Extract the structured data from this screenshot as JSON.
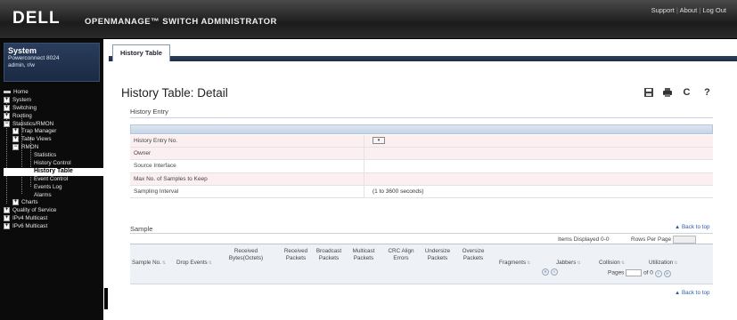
{
  "header": {
    "logo": "DELL",
    "app_title": "OPENMANAGE™ SWITCH ADMINISTRATOR",
    "links": {
      "support": "Support",
      "about": "About",
      "logout": "Log Out",
      "sep": "|"
    }
  },
  "system": {
    "title": "System",
    "model": "Powerconnect 8024",
    "user": "admin, r/w"
  },
  "nav": {
    "home": "Home",
    "system": "System",
    "switching": "Switching",
    "routing": "Routing",
    "statistics_rmon": "Statistics/RMON",
    "trap_manager": "Trap Manager",
    "table_views": "Table Views",
    "rmon": "RMON",
    "rmon_statistics": "Statistics",
    "history_control": "History Control",
    "history_table": "History Table",
    "event_control": "Event Control",
    "events_log": "Events Log",
    "alarms": "Alarms",
    "charts": "Charts",
    "qos": "Quality of Service",
    "ipv4_multicast": "IPv4 Multicast",
    "ipv6_multicast": "IPv6 Multicast"
  },
  "tabs": {
    "active": "History Table"
  },
  "page": {
    "title": "History Table: Detail",
    "toolbar": {
      "save_icon": "save-icon",
      "print_icon": "print-icon",
      "refresh_icon": "refresh-icon",
      "help_icon": "help-icon"
    }
  },
  "history_entry": {
    "heading": "History Entry",
    "rows": [
      {
        "label": "History Entry No.",
        "value": ""
      },
      {
        "label": "Owner",
        "value": ""
      },
      {
        "label": "Source Interface",
        "value": ""
      },
      {
        "label": "Max No. of Samples to Keep",
        "value": ""
      },
      {
        "label": "Sampling Interval",
        "value": "(1 to 3600 seconds)"
      }
    ]
  },
  "sample": {
    "heading": "Sample",
    "back_to_top": "Back to top",
    "items_displayed": "Items Displayed 0-0",
    "rows_per_page": "Rows Per Page",
    "columns": [
      {
        "label": "Sample No."
      },
      {
        "label": "Drop Events"
      },
      {
        "label": "Received Bytes(Octets)"
      },
      {
        "label": "Received Packets"
      },
      {
        "label": "Broadcast Packets"
      },
      {
        "label": "Multicast Packets"
      },
      {
        "label": "CRC Align Errors"
      },
      {
        "label": "Undersize Packets"
      },
      {
        "label": "Oversize Packets"
      },
      {
        "label": "Fragments"
      },
      {
        "label": "Jabbers"
      },
      {
        "label": "Collision"
      },
      {
        "label": "Utilization"
      }
    ],
    "pages_label": "Pages",
    "of_label": "of 0"
  }
}
